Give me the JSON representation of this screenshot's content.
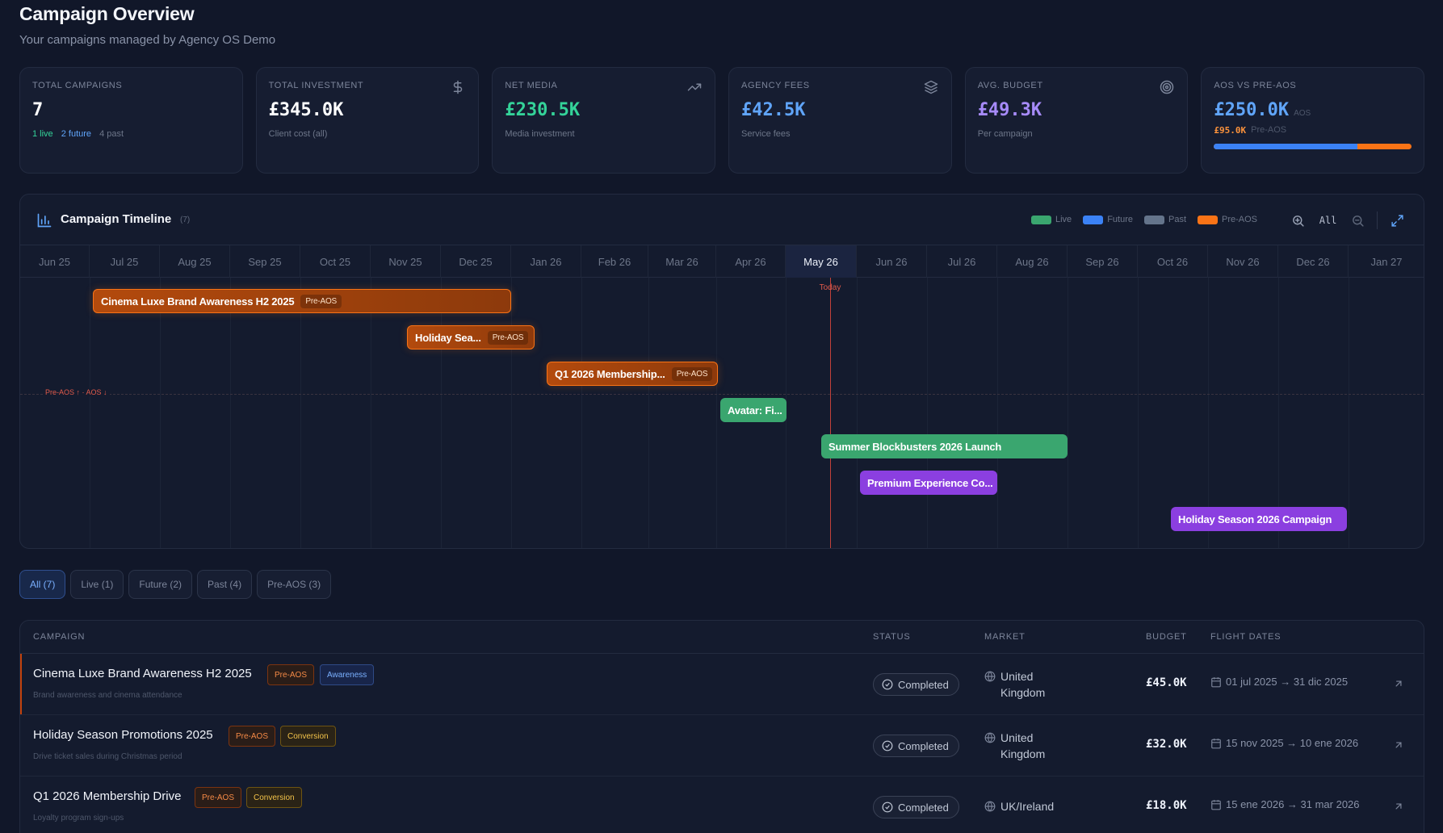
{
  "header": {
    "title": "Campaign Overview",
    "subtitle": "Your campaigns managed by Agency OS Demo"
  },
  "stats": {
    "total_campaigns": {
      "label": "TOTAL CAMPAIGNS",
      "value": "7",
      "live": "1 live",
      "future": "2 future",
      "past": "4 past"
    },
    "total_investment": {
      "label": "TOTAL INVESTMENT",
      "value": "£345.0K",
      "sub": "Client cost (all)",
      "icon": "dollar-icon",
      "color": "#ffffff"
    },
    "net_media": {
      "label": "NET MEDIA",
      "value": "£230.5K",
      "sub": "Media investment",
      "icon": "trending-up-icon",
      "color": "#34d399"
    },
    "agency_fees": {
      "label": "AGENCY FEES",
      "value": "£42.5K",
      "sub": "Service fees",
      "icon": "layers-icon",
      "color": "#60a5fa"
    },
    "avg_budget": {
      "label": "AVG. BUDGET",
      "value": "£49.3K",
      "sub": "Per campaign",
      "icon": "target-icon",
      "color": "#a78bfa"
    },
    "aos_vs_pre": {
      "label": "AOS VS PRE-AOS",
      "aos_value": "£250.0K",
      "aos_label": "AOS",
      "pre_value": "£95.0K",
      "pre_label": "Pre-AOS",
      "aos_fraction": 0.725
    }
  },
  "timeline": {
    "title": "Campaign Timeline",
    "count": "(7)",
    "legend": [
      {
        "label": "Live",
        "color": "#3aa66f"
      },
      {
        "label": "Future",
        "color": "#3b82f6"
      },
      {
        "label": "Past",
        "color": "#64748b"
      },
      {
        "label": "Pre-AOS",
        "color": "#f97316"
      }
    ],
    "zoom_label": "All",
    "months": [
      "Jun 25",
      "Jul 25",
      "Aug 25",
      "Sep 25",
      "Oct 25",
      "Nov 25",
      "Dec 25",
      "Jan 26",
      "Feb 26",
      "Mar 26",
      "Apr 26",
      "May 26",
      "Jun 26",
      "Jul 26",
      "Aug 26",
      "Sep 26",
      "Oct 26",
      "Nov 26",
      "Dec 26",
      "Jan 27"
    ],
    "current_month": "May 26",
    "today_label": "Today",
    "divider_label": "Pre-AOS ↑ · AOS ↓",
    "bars": [
      {
        "label": "Cinema Luxe Brand Awareness H2 2025",
        "tag": "Pre-AOS",
        "kind": "preaos"
      },
      {
        "label": "Holiday Sea...",
        "tag": "Pre-AOS",
        "kind": "preaos"
      },
      {
        "label": "Q1 2026 Membership...",
        "tag": "Pre-AOS",
        "kind": "preaos"
      },
      {
        "label": "Avatar: Fi...",
        "tag": "",
        "kind": "live"
      },
      {
        "label": "Summer Blockbusters 2026 Launch",
        "tag": "",
        "kind": "live"
      },
      {
        "label": "Premium Experience Co...",
        "tag": "",
        "kind": "future"
      },
      {
        "label": "Holiday Season 2026 Campaign",
        "tag": "",
        "kind": "future"
      }
    ]
  },
  "filters": [
    "All (7)",
    "Live (1)",
    "Future (2)",
    "Past (4)",
    "Pre-AOS (3)"
  ],
  "table": {
    "headers": {
      "campaign": "CAMPAIGN",
      "status": "STATUS",
      "market": "MARKET",
      "budget": "BUDGET",
      "flight": "FLIGHT DATES"
    },
    "rows": [
      {
        "name": "Cinema Luxe Brand Awareness H2 2025",
        "tag1": "Pre-AOS",
        "tag2": "Awareness",
        "desc": "Brand awareness and cinema attendance",
        "status": "Completed",
        "market_l1": "United",
        "market_l2": "Kingdom",
        "budget": "£45.0K",
        "dates": "01 jul 2025 → 31 dic 2025"
      },
      {
        "name": "Holiday Season Promotions 2025",
        "tag1": "Pre-AOS",
        "tag2": "Conversion",
        "desc": "Drive ticket sales during Christmas period",
        "status": "Completed",
        "market_l1": "United",
        "market_l2": "Kingdom",
        "budget": "£32.0K",
        "dates": "15 nov 2025 → 10 ene 2026"
      },
      {
        "name": "Q1 2026 Membership Drive",
        "tag1": "Pre-AOS",
        "tag2": "Conversion",
        "desc": "Loyalty program sign-ups",
        "status": "Completed",
        "market_l1": "UK/Ireland",
        "market_l2": "",
        "budget": "£18.0K",
        "dates": "15 ene 2026 → 31 mar 2026"
      }
    ]
  }
}
